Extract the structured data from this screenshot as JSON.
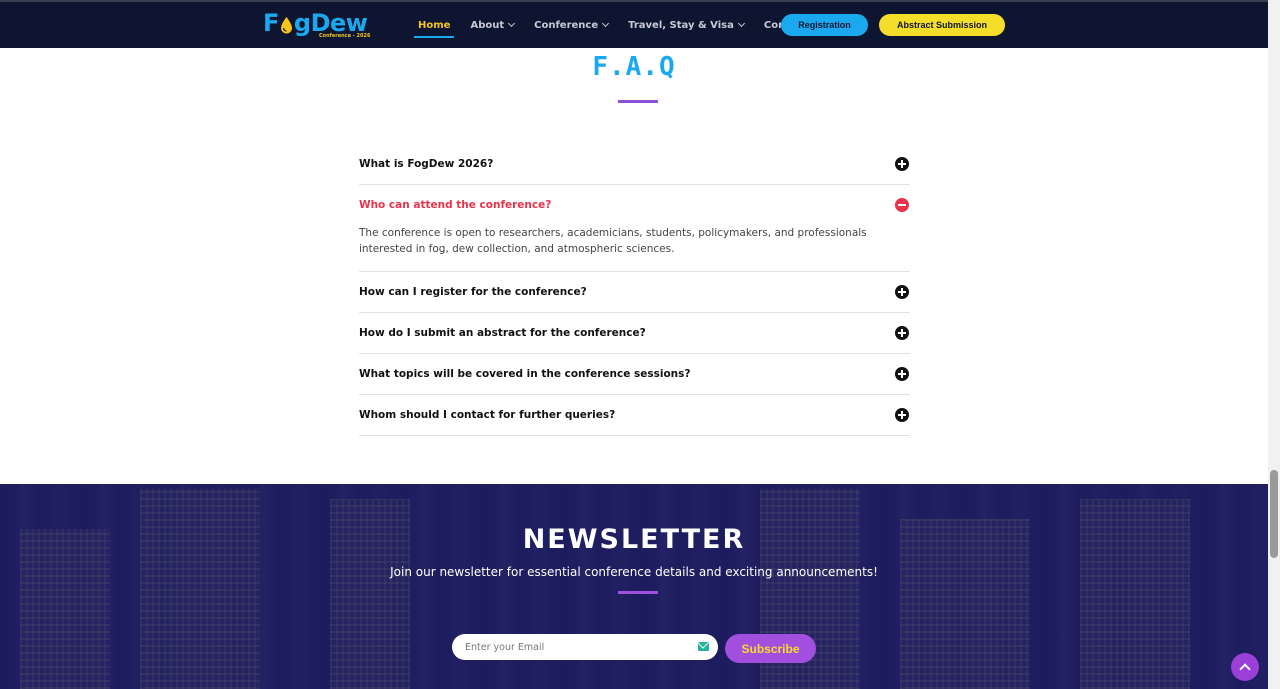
{
  "brand": {
    "name": "FogDew",
    "name_part1": "F",
    "name_part2": "gDew",
    "tagline": "Conference - 2026"
  },
  "nav": {
    "items": [
      {
        "label": "Home",
        "active": true,
        "has_dropdown": false
      },
      {
        "label": "About",
        "active": false,
        "has_dropdown": true
      },
      {
        "label": "Conference",
        "active": false,
        "has_dropdown": true
      },
      {
        "label": "Travel, Stay & Visa",
        "active": false,
        "has_dropdown": true
      },
      {
        "label": "Contact",
        "active": false,
        "has_dropdown": false
      }
    ],
    "registration_label": "Registration",
    "abstract_label": "Abstract Submission"
  },
  "faq": {
    "title": "F.A.Q",
    "items": [
      {
        "question": "What is FogDew 2026?",
        "open": false,
        "answer": ""
      },
      {
        "question": "Who can attend the conference?",
        "open": true,
        "answer": "The conference is open to researchers, academicians, students, policymakers, and professionals interested in fog, dew collection, and atmospheric sciences."
      },
      {
        "question": "How can I register for the conference?",
        "open": false,
        "answer": ""
      },
      {
        "question": "How do I submit an abstract for the conference?",
        "open": false,
        "answer": ""
      },
      {
        "question": "What topics will be covered in the conference sessions?",
        "open": false,
        "answer": ""
      },
      {
        "question": "Whom should I contact for further queries?",
        "open": false,
        "answer": ""
      }
    ]
  },
  "newsletter": {
    "title": "NEWSLETTER",
    "subtitle": "Join our newsletter for essential conference details and exciting announcements!",
    "email_placeholder": "Enter your Email",
    "subscribe_label": "Subscribe"
  },
  "colors": {
    "nav_bg": "#0e1530",
    "accent_blue": "#1aa8ef",
    "accent_yellow": "#f5de2a",
    "accent_purple": "#a24fe0",
    "open_red": "#e8334a"
  },
  "icons": [
    "fogdew-logo-drop-icon",
    "chevron-down-icon",
    "plus-circle-icon",
    "minus-circle-icon",
    "mail-icon",
    "arrow-up-icon"
  ]
}
